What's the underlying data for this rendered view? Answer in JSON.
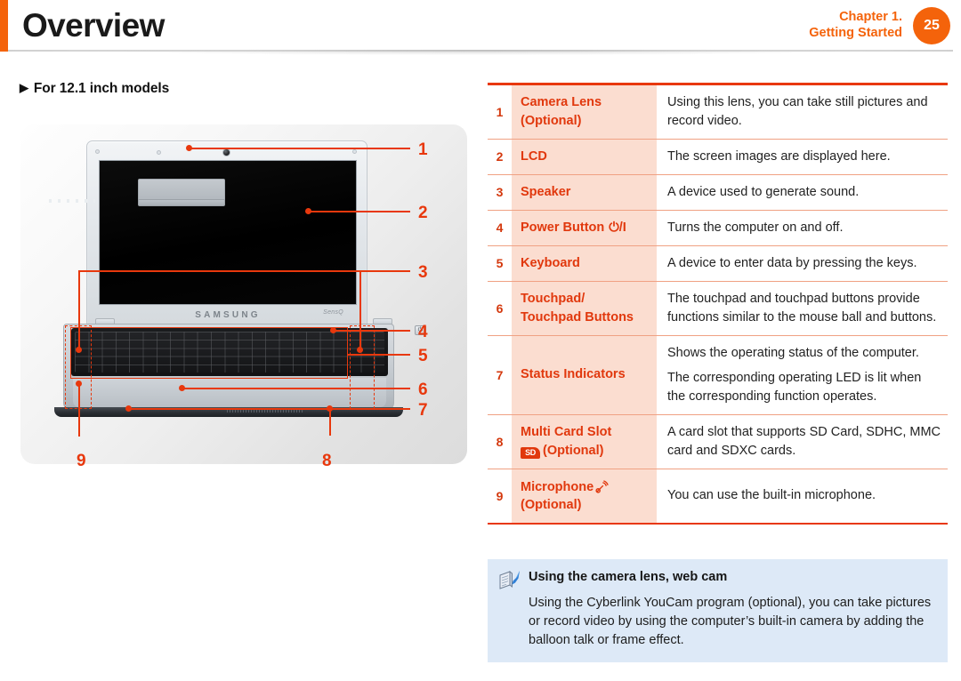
{
  "header": {
    "title": "Overview",
    "chapter_line1": "Chapter 1.",
    "chapter_line2": "Getting Started",
    "page_number": "25",
    "accent_color": "#f4630b"
  },
  "left": {
    "section_heading": "For 12.1 inch models",
    "bullet_glyph": "▶",
    "figure": {
      "brand": "SAMSUNG",
      "sublogo": "SensQ",
      "power_key_glyph": "⏻",
      "callouts": [
        "1",
        "2",
        "3",
        "4",
        "5",
        "6",
        "7",
        "8",
        "9"
      ]
    }
  },
  "table": {
    "accent_color": "#e8380d",
    "label_bg": "#fbddd0",
    "rows": [
      {
        "num": "1",
        "label_lines": [
          "Camera Lens",
          "(Optional)"
        ],
        "desc": [
          "Using this lens, you can take still pictures and record video."
        ]
      },
      {
        "num": "2",
        "label_lines": [
          "LCD"
        ],
        "desc": [
          "The screen images are displayed here."
        ]
      },
      {
        "num": "3",
        "label_lines": [
          "Speaker"
        ],
        "desc": [
          "A device used to generate sound."
        ]
      },
      {
        "num": "4",
        "label_lines": [
          "Power Button"
        ],
        "label_icon": "⏻/I",
        "icon_name": "power-icon",
        "desc": [
          "Turns the computer on and off."
        ]
      },
      {
        "num": "5",
        "label_lines": [
          "Keyboard"
        ],
        "desc": [
          "A device to enter data by pressing the keys."
        ]
      },
      {
        "num": "6",
        "label_lines": [
          "Touchpad/",
          "Touchpad Buttons"
        ],
        "desc": [
          "The touchpad and touchpad buttons provide functions similar to the mouse ball and buttons."
        ]
      },
      {
        "num": "7",
        "label_lines": [
          "Status Indicators"
        ],
        "desc": [
          "Shows the operating status of the computer.",
          "The corresponding operating LED is lit when the corresponding function operates."
        ]
      },
      {
        "num": "8",
        "label_lines": [
          "Multi Card Slot"
        ],
        "label_suffix": "(Optional)",
        "icon_name": "sd-card-icon",
        "icon_text": "SD",
        "desc": [
          "A card slot that supports SD Card, SDHC, MMC card and SDXC cards."
        ]
      },
      {
        "num": "9",
        "label_lines": [
          "Microphone"
        ],
        "label_suffix": "(Optional)",
        "icon_name": "microphone-icon",
        "desc": [
          "You can use the built-in microphone."
        ]
      }
    ]
  },
  "note": {
    "icon_name": "note-pen-icon",
    "title": "Using the camera lens, web cam",
    "body": "Using the Cyberlink YouCam program (optional), you can take pictures or record video by using the computer’s built-in camera by adding the balloon talk or frame effect.",
    "bg_color": "#dde9f7"
  }
}
